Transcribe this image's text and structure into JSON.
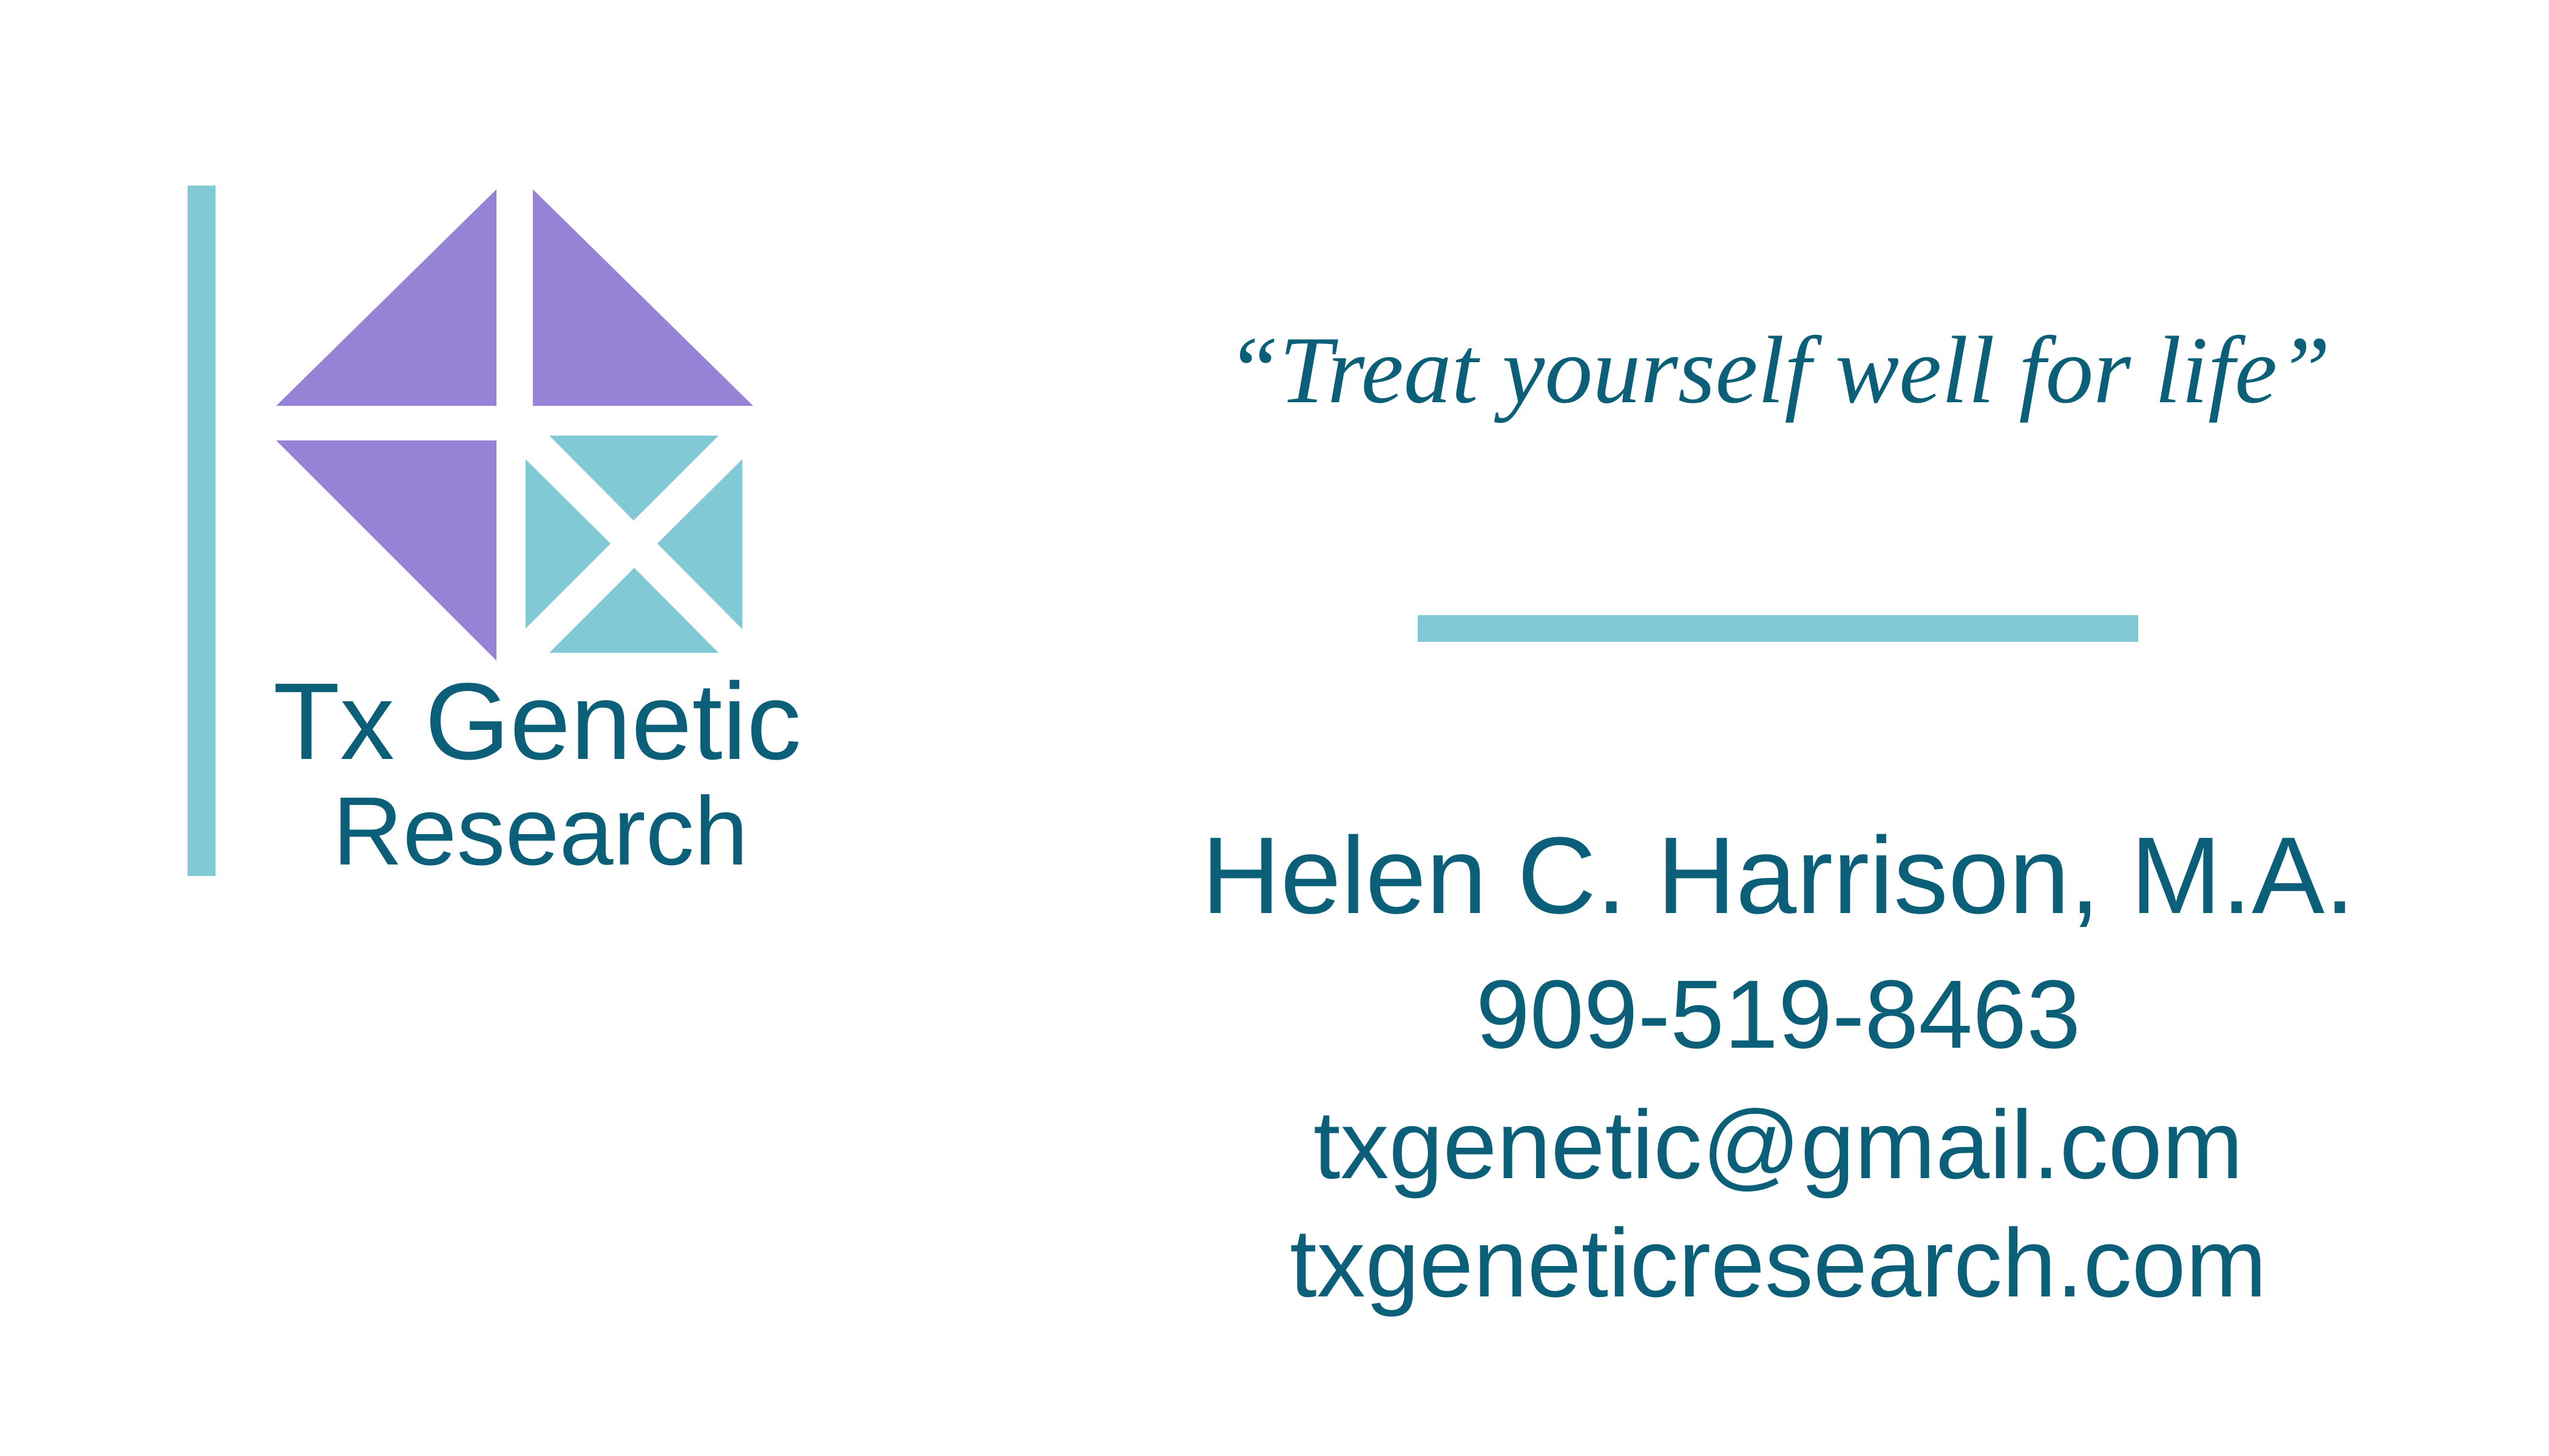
{
  "colors": {
    "text": "#0b5f78",
    "purple": "#9683d6",
    "teal": "#82c9d6"
  },
  "logo": {
    "line1": "Tx Genetic",
    "line2": "Research"
  },
  "tagline": "“Treat yourself well for life”",
  "contact": {
    "name": "Helen C. Harrison, M.A.",
    "phone": "909-519-8463",
    "email": "txgenetic@gmail.com",
    "website": "txgeneticresearch.com"
  }
}
